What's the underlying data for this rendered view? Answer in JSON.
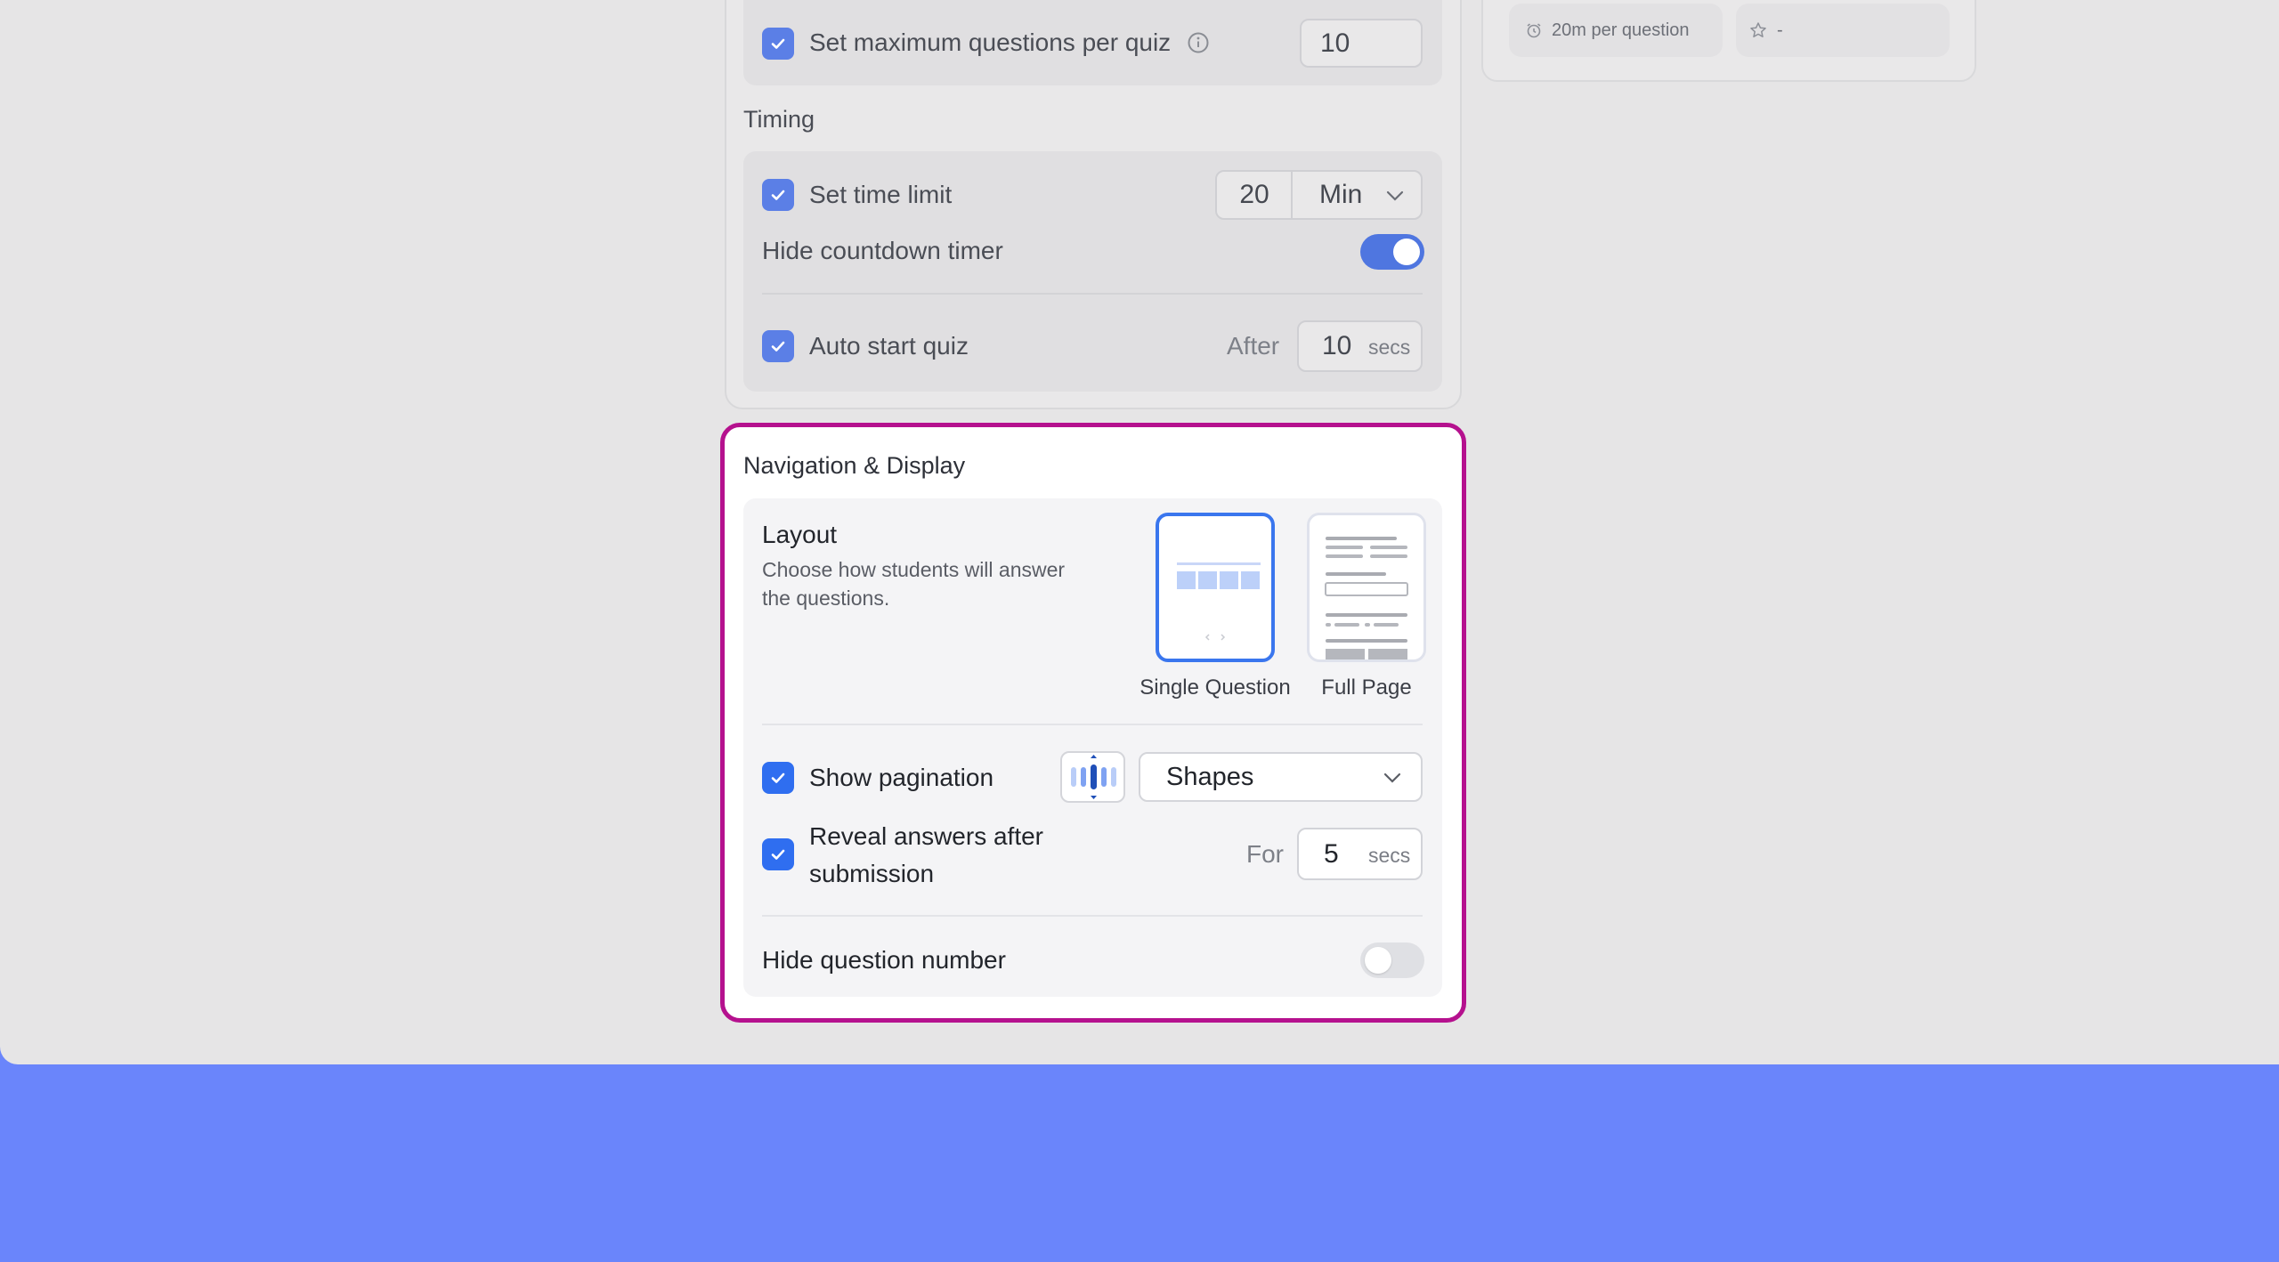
{
  "quiz_settings": {
    "max_questions": {
      "label": "Set maximum questions per quiz",
      "checked": true,
      "value": "10"
    },
    "timing": {
      "title": "Timing",
      "time_limit": {
        "label": "Set time limit",
        "checked": true,
        "value": "20",
        "unit": "Min"
      },
      "hide_countdown": {
        "label": "Hide countdown timer",
        "on": true
      },
      "auto_start": {
        "label": "Auto start quiz",
        "checked": true,
        "prefix": "After",
        "value": "10",
        "unit": "secs"
      }
    }
  },
  "summary": {
    "time_chip": "20m per question",
    "rating_chip": "-"
  },
  "navigation_display": {
    "title": "Navigation & Display",
    "layout": {
      "heading": "Layout",
      "description_line1": "Choose how students will answer",
      "description_line2": "the questions.",
      "options": [
        {
          "label": "Single Question",
          "selected": true
        },
        {
          "label": "Full Page",
          "selected": false
        }
      ]
    },
    "pagination": {
      "label": "Show pagination",
      "checked": true,
      "style": "Shapes"
    },
    "reveal_answers": {
      "label_line1": "Reveal answers after",
      "label_line2": "submission",
      "checked": true,
      "prefix": "For",
      "value": "5",
      "unit": "secs"
    },
    "hide_question_number": {
      "label": "Hide question number",
      "on": false
    }
  },
  "colors": {
    "accent": "#2f6ef0",
    "highlight_border": "#b5118e",
    "bottom_band": "#6a85fb"
  }
}
